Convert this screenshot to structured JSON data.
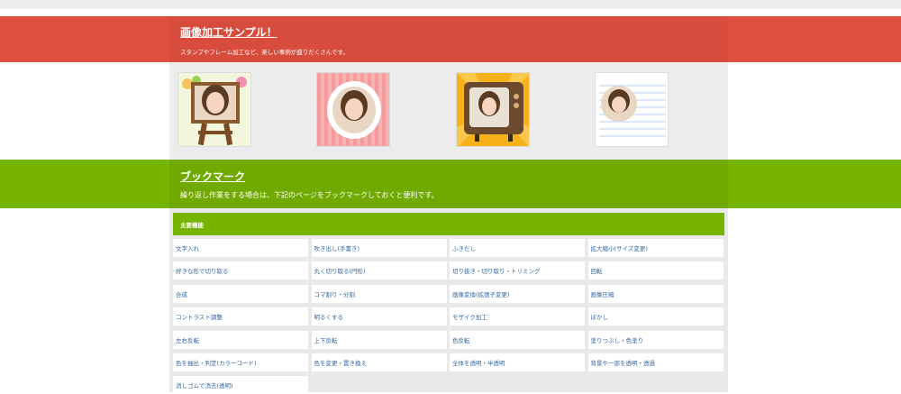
{
  "samples_section": {
    "title": "画像加工サンプル！",
    "subtitle": "スタンプやフレーム加工など、楽しい事例が盛りだくさんです。",
    "thumbnails": [
      {
        "label": "フレーム（イーゼル）"
      },
      {
        "label": "フレーム（ピンク）"
      },
      {
        "label": "フレーム（テレビ）"
      },
      {
        "label": "フレーム（ノート）"
      }
    ]
  },
  "bookmark_section": {
    "title": "ブックマーク",
    "subtitle": "繰り返し作業をする場合は、下記のページをブックマークしておくと便利です。"
  },
  "features_panel": {
    "header": "主要機能",
    "items": [
      "文字入れ",
      "吹き出し(手書き)",
      "ふきだし",
      "拡大縮小(サイズ変更)",
      "好きな形で切り取る",
      "丸く切り取る(円形)",
      "切り抜き・切り取り・トリミング",
      "回転",
      "合成",
      "コマ割り・分割",
      "画像変換(拡張子変更)",
      "画像圧縮",
      "コントラスト調整",
      "明るくする",
      "モザイク加工",
      "ぼかし",
      "左右反転",
      "上下反転",
      "色反転",
      "塗りつぶし・色塗り",
      "色を抽出・判定(カラーコード)",
      "色を変更・置き換え",
      "全体を透明・半透明",
      "背景や一部を透明・透過",
      "消しゴムで消去(透明)"
    ]
  },
  "colors": {
    "red_band": "#e05040",
    "green_band": "#77b400",
    "link": "#3366a3"
  }
}
